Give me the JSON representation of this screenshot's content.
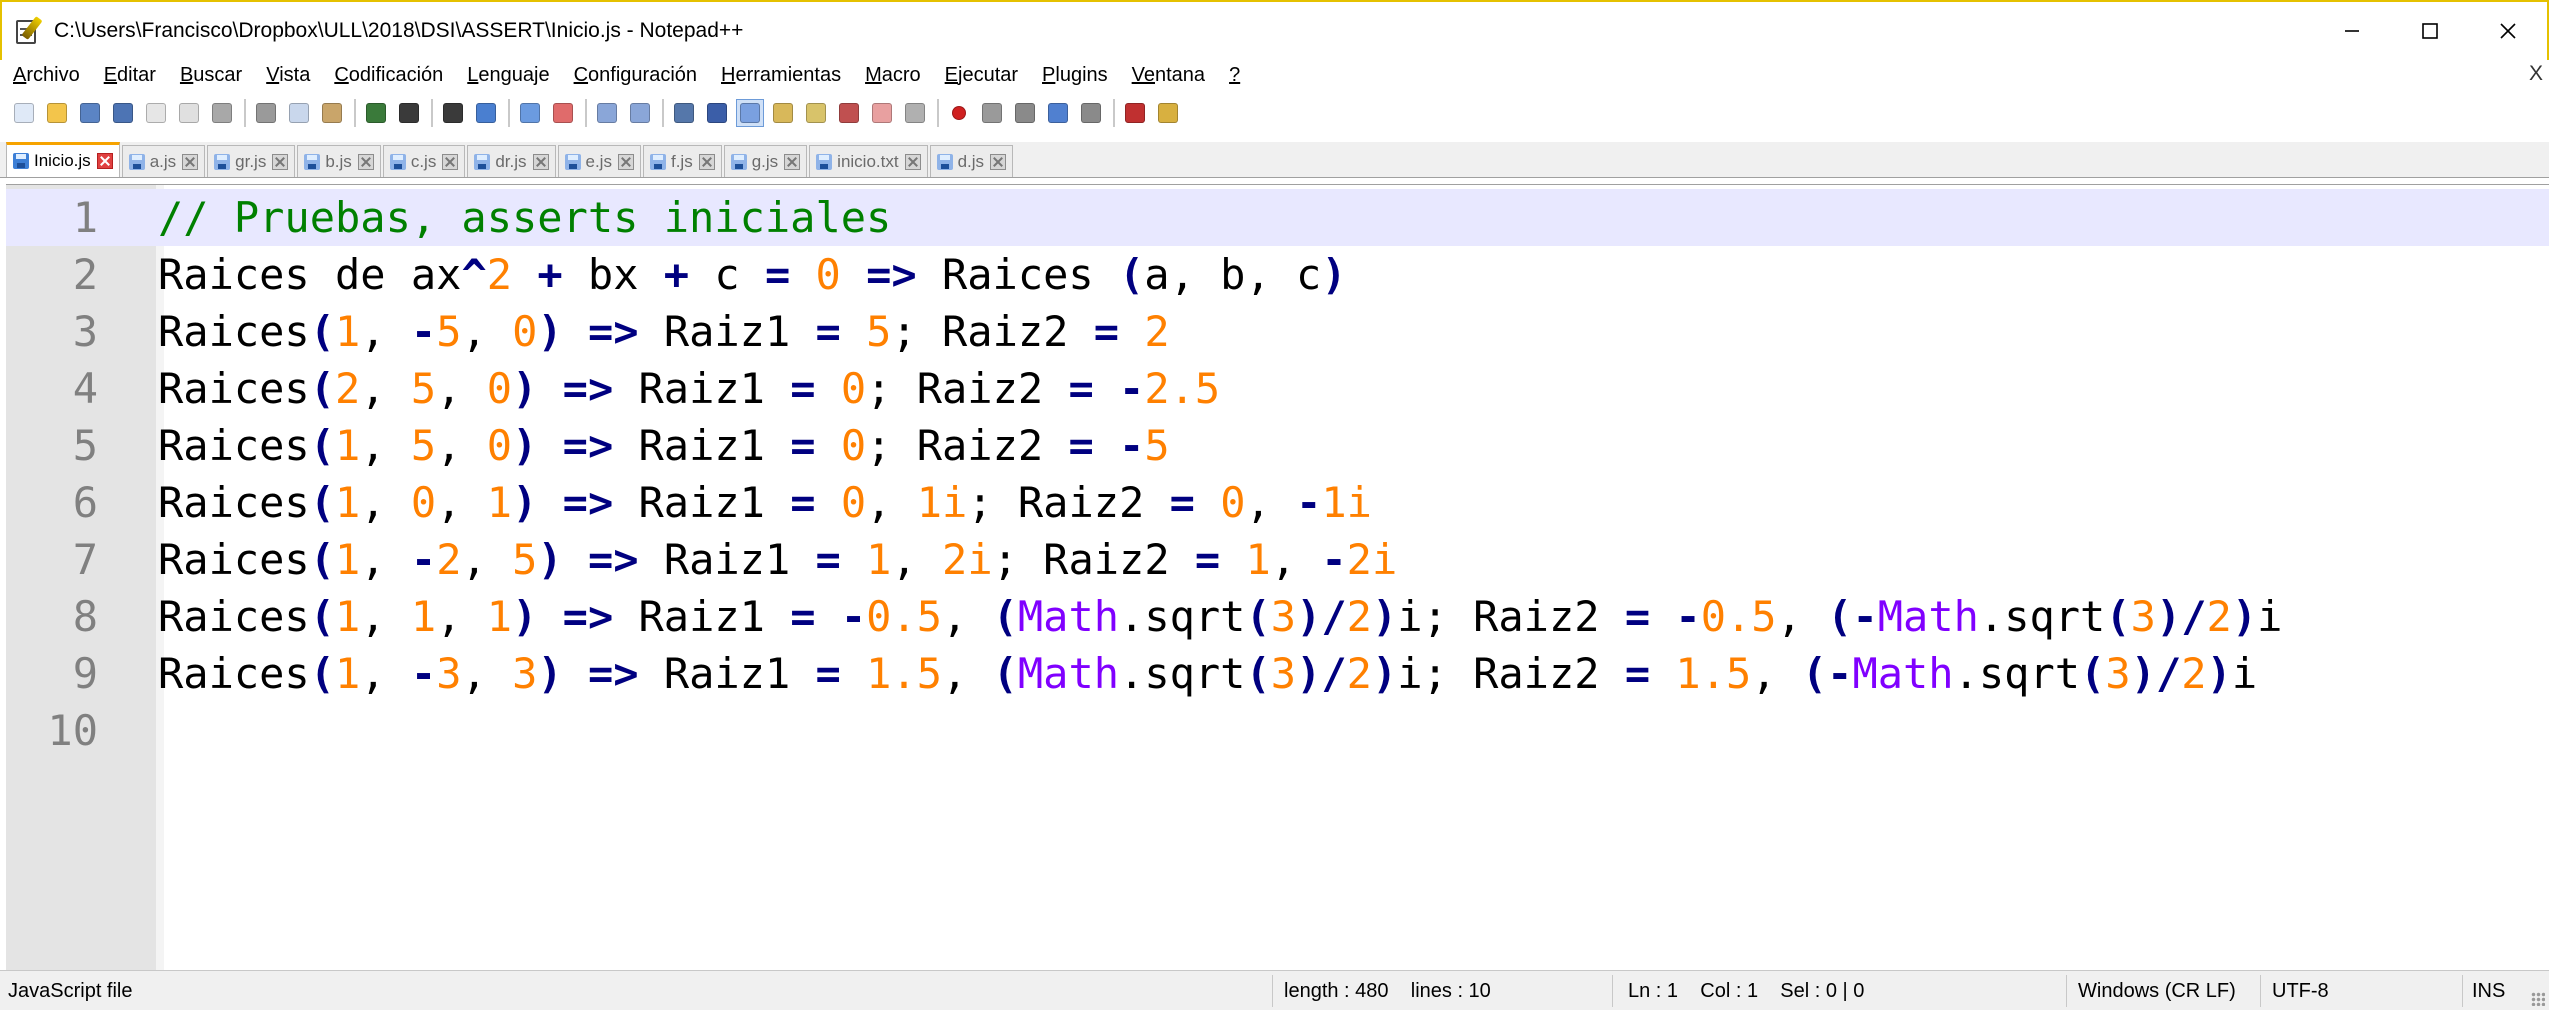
{
  "window": {
    "title": "C:\\Users\\Francisco\\Dropbox\\ULL\\2018\\DSI\\ASSERT\\Inicio.js - Notepad++",
    "minimize_icon": "minimize-icon",
    "maximize_icon": "maximize-icon",
    "close_icon": "close-icon"
  },
  "menu": {
    "items": [
      {
        "u": "A",
        "rest": "rchivo"
      },
      {
        "u": "E",
        "rest": "ditar"
      },
      {
        "u": "B",
        "rest": "uscar"
      },
      {
        "u": "V",
        "rest": "ista"
      },
      {
        "u": "C",
        "rest": "odificación"
      },
      {
        "u": "L",
        "rest": "enguaje"
      },
      {
        "u": "C",
        "rest": "onfiguración"
      },
      {
        "u": "H",
        "rest": "erramientas"
      },
      {
        "u": "M",
        "rest": "acro"
      },
      {
        "u": "E",
        "rest": "jecutar"
      },
      {
        "u": "P",
        "rest": "lugins"
      },
      {
        "u": "Ve",
        "rest": "ntana",
        "prefix": true
      },
      {
        "u": "?",
        "rest": ""
      }
    ],
    "close_label": "X"
  },
  "toolbar": {
    "icons": [
      "new-file-icon",
      "open-file-icon",
      "save-icon",
      "save-all-icon",
      "close-icon",
      "close-all-icon",
      "print-icon",
      "|",
      "cut-icon",
      "copy-icon",
      "paste-icon",
      "|",
      "undo-icon",
      "redo-icon",
      "|",
      "find-icon",
      "replace-icon",
      "|",
      "zoom-in-icon",
      "zoom-out-icon",
      "|",
      "sync-vertical-icon",
      "sync-horizontal-icon",
      "|",
      "word-wrap-icon",
      "show-all-chars-icon",
      "indent-guide-icon",
      "user-language-icon",
      "doc-map-icon",
      "function-list-icon",
      "folder-workspace-icon",
      "monitoring-icon",
      "|",
      "record-macro-icon",
      "stop-record-icon",
      "play-macro-icon",
      "run-macro-multiple-icon",
      "save-macro-icon",
      "|",
      "spell-check-icon",
      "auto-spell-icon"
    ]
  },
  "tabs": [
    {
      "label": "Inicio.js",
      "active": true
    },
    {
      "label": "a.js",
      "active": false
    },
    {
      "label": "gr.js",
      "active": false
    },
    {
      "label": "b.js",
      "active": false
    },
    {
      "label": "c.js",
      "active": false
    },
    {
      "label": "dr.js",
      "active": false
    },
    {
      "label": "e.js",
      "active": false
    },
    {
      "label": "f.js",
      "active": false
    },
    {
      "label": "g.js",
      "active": false
    },
    {
      "label": "inicio.txt",
      "active": false
    },
    {
      "label": "d.js",
      "active": false
    }
  ],
  "editor": {
    "current_line": 1,
    "lines": [
      "// Pruebas, asserts iniciales",
      "Raices de ax^2 + bx + c = 0 => Raices (a, b, c)",
      "Raices(1, -5, 0) => Raiz1 = 5; Raiz2 = 2",
      "Raices(2, 5, 0) => Raiz1 = 0; Raiz2 = -2.5",
      "Raices(1, 5, 0) => Raiz1 = 0; Raiz2 = -5",
      "Raices(1, 0, 1) => Raiz1 = 0, 1i; Raiz2 = 0, -1i",
      "Raices(1, -2, 5) => Raiz1 = 1, 2i; Raiz2 = 1, -2i",
      "Raices(1, 1, 1) => Raiz1 = -0.5, (Math.sqrt(3)/2)i; Raiz2 = -0.5, (-Math.sqrt(3)/2)i",
      "Raices(1, -3, 3) => Raiz1 = 1.5, (Math.sqrt(3)/2)i; Raiz2 = 1.5, (-Math.sqrt(3)/2)i",
      ""
    ]
  },
  "status": {
    "file_type": "JavaScript file",
    "length": "length : 480    lines : 10",
    "position": "Ln : 1    Col : 1    Sel : 0 | 0",
    "eol": "Windows (CR LF)",
    "encoding": "UTF-8",
    "mode": "INS"
  },
  "colors": {
    "comment": "#008000",
    "number": "#ff8000",
    "operator": "#000080",
    "keyword": "#8000ff",
    "current_line": "#e8e8ff",
    "active_tab_accent": "#f6a300"
  }
}
